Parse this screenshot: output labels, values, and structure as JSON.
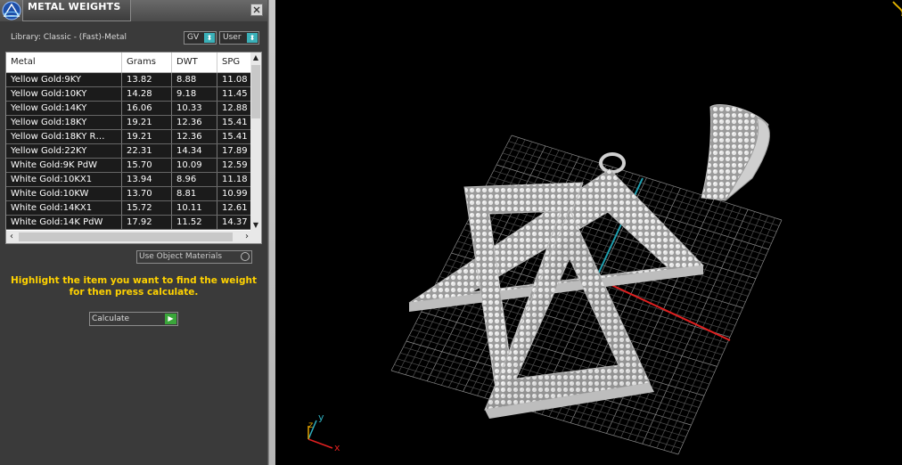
{
  "panel": {
    "title": "METAL WEIGHTS",
    "library_label": "Library: Classic - (Fast)-Metal",
    "gv_select": "GV",
    "user_select": "User",
    "use_object_materials": "Use Object Materials",
    "hint": "Highlight the item you want to find the weight for then press calculate.",
    "calculate_label": "Calculate"
  },
  "table": {
    "headers": [
      "Metal",
      "Grams",
      "DWT",
      "SPG"
    ],
    "rows": [
      [
        "Yellow Gold:9KY",
        "13.82",
        "8.88",
        "11.08"
      ],
      [
        "Yellow Gold:10KY",
        "14.28",
        "9.18",
        "11.45"
      ],
      [
        "Yellow Gold:14KY",
        "16.06",
        "10.33",
        "12.88"
      ],
      [
        "Yellow Gold:18KY",
        "19.21",
        "12.36",
        "15.41"
      ],
      [
        "Yellow Gold:18KY R…",
        "19.21",
        "12.36",
        "15.41"
      ],
      [
        "Yellow Gold:22KY",
        "22.31",
        "14.34",
        "17.89"
      ],
      [
        "White Gold:9K PdW",
        "15.70",
        "10.09",
        "12.59"
      ],
      [
        "White Gold:10KX1",
        "13.94",
        "8.96",
        "11.18"
      ],
      [
        "White Gold:10KW",
        "13.70",
        "8.81",
        "10.99"
      ],
      [
        "White Gold:14KX1",
        "15.72",
        "10.11",
        "12.61"
      ],
      [
        "White Gold:14K PdW",
        "17.92",
        "11.52",
        "14.37"
      ]
    ]
  },
  "viewport": {
    "axis_labels": {
      "x": "x",
      "y": "y",
      "z": "z"
    },
    "colors": {
      "x_axis": "#e02020",
      "y_axis": "#20a0b0",
      "grid": "#6a6a6a",
      "model": "#d8d8d8"
    }
  }
}
